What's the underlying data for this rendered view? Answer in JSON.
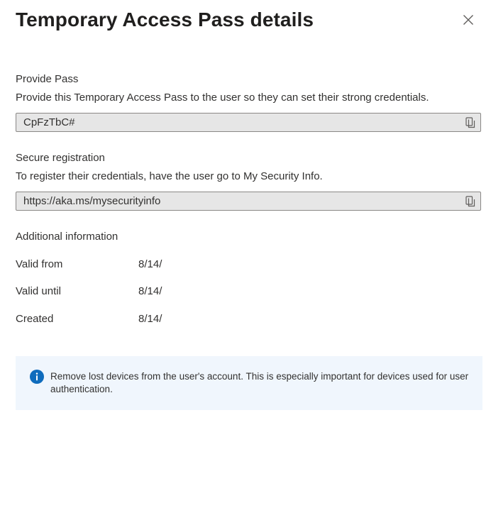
{
  "dialog": {
    "title": "Temporary Access Pass details",
    "close_icon": "close-icon"
  },
  "provide_pass": {
    "label": "Provide Pass",
    "description": "Provide this Temporary Access Pass to the user so they can set their strong credentials.",
    "value": "CpFzTbC#",
    "copy_icon": "copy-icon"
  },
  "secure_registration": {
    "label": "Secure registration",
    "description": "To register their credentials, have the user go to My Security Info.",
    "value": "https://aka.ms/mysecurityinfo",
    "copy_icon": "copy-icon"
  },
  "additional_info": {
    "heading": "Additional information",
    "rows": [
      {
        "key": "Valid from",
        "value": "8/14/"
      },
      {
        "key": "Valid until",
        "value": "8/14/"
      },
      {
        "key": "Created",
        "value": "8/14/"
      }
    ]
  },
  "notice": {
    "icon": "info-icon",
    "text": "Remove lost devices from the user's account. This is especially important for devices used for user authentication.",
    "accent_color": "#0f6cbd",
    "background_color": "#f0f6fd"
  }
}
